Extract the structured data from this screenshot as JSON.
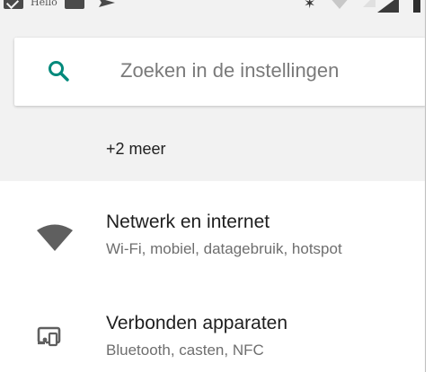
{
  "status_bar": {
    "icons": [
      "gmail-icon",
      "image-icon",
      "send-icon",
      "bluetooth-icon",
      "wifi-icon",
      "signal-icon",
      "battery-icon"
    ],
    "notification_text": "Hello"
  },
  "search": {
    "icon": "search-icon",
    "placeholder": "Zoeken in de instellingen",
    "accent_color": "#00897b"
  },
  "more": {
    "label": "+2 meer"
  },
  "settings_items": [
    {
      "icon": "wifi-icon",
      "title": "Netwerk en internet",
      "subtitle": "Wi-Fi, mobiel, datagebruik, hotspot"
    },
    {
      "icon": "connected-devices-icon",
      "title": "Verbonden apparaten",
      "subtitle": "Bluetooth, casten, NFC"
    }
  ],
  "colors": {
    "background": "#f2f2f2",
    "card": "#ffffff",
    "icon": "#5f5f5f",
    "primary_text": "#1e1e1e",
    "secondary_text": "#6e6e6e"
  }
}
